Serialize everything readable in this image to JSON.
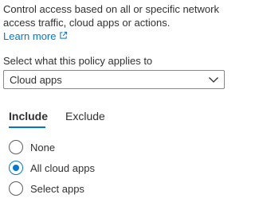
{
  "description": {
    "line1": "Control access based on all or specific network",
    "line2": "access traffic, cloud apps or actions.",
    "learn_more": "Learn more",
    "learn_more_icon": "external-link-icon",
    "link_color": "#0078d4"
  },
  "policy_applies": {
    "label": "Select what this policy applies to",
    "selected": "Cloud apps",
    "dropdown_icon": "chevron-down-icon"
  },
  "tabs": [
    {
      "label": "Include",
      "active": true
    },
    {
      "label": "Exclude",
      "active": false
    }
  ],
  "options": [
    {
      "label": "None",
      "checked": false
    },
    {
      "label": "All cloud apps",
      "checked": true
    },
    {
      "label": "Select apps",
      "checked": false
    }
  ],
  "accent_color": "#0078d4"
}
